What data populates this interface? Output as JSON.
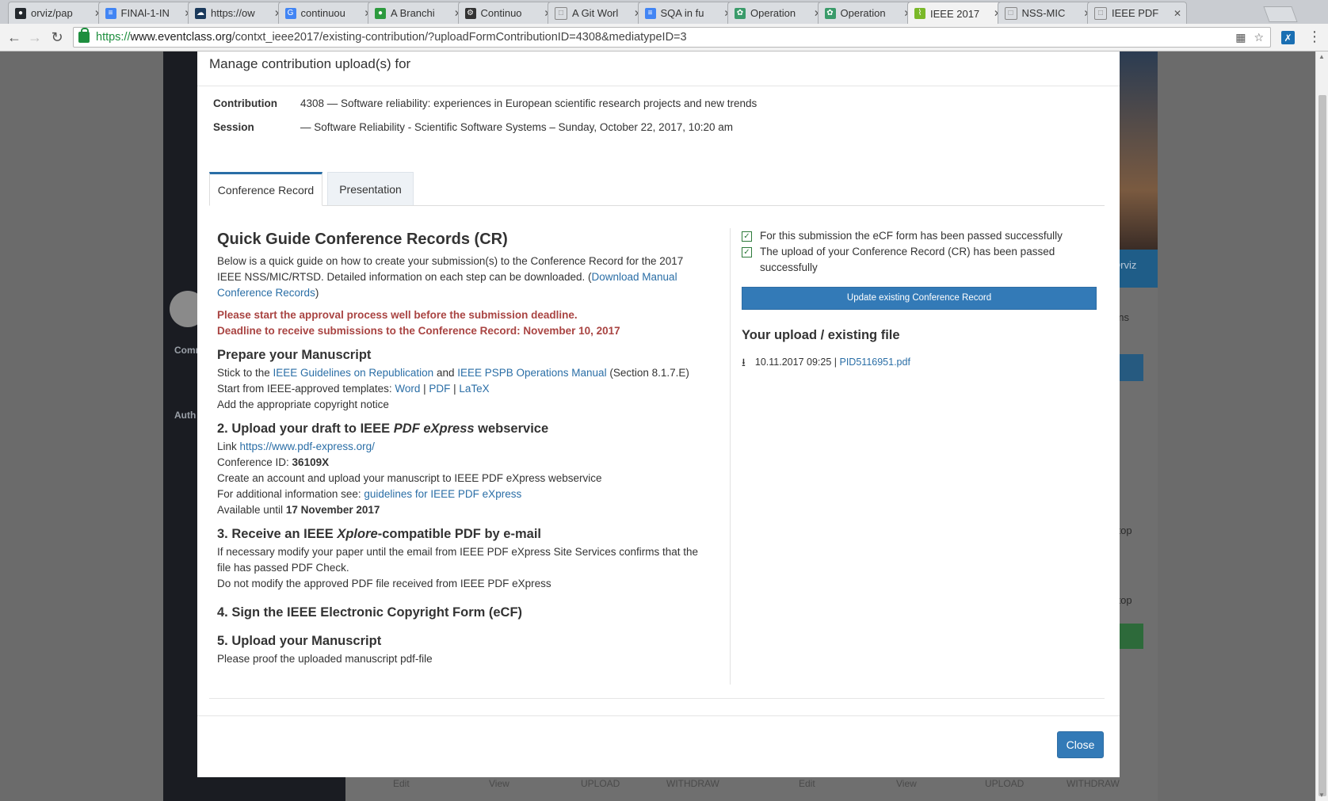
{
  "browser": {
    "tabs": [
      {
        "title": "orviz/pap",
        "icon": "github-icon",
        "color": "#24292e"
      },
      {
        "title": "FINAl-1-IN",
        "icon": "google-docs-icon",
        "color": "#4285f4"
      },
      {
        "title": "https://ow",
        "icon": "cloud-icon",
        "color": "#1b3a5c"
      },
      {
        "title": "continuou",
        "icon": "google-icon",
        "color": "#4285f4"
      },
      {
        "title": "A Branchi",
        "icon": "branch-icon",
        "color": "#2c9a3e"
      },
      {
        "title": "Continuo",
        "icon": "bug-icon",
        "color": "#333333"
      },
      {
        "title": "A Git Worl",
        "icon": "page-icon",
        "color": "#888888"
      },
      {
        "title": "SQA in fu",
        "icon": "google-docs-icon",
        "color": "#4285f4"
      },
      {
        "title": "Operation",
        "icon": "octopus-icon",
        "color": "#3a9b6a"
      },
      {
        "title": "Operation",
        "icon": "octopus-icon",
        "color": "#3a9b6a"
      },
      {
        "title": "IEEE 2017",
        "icon": "ieee-icon",
        "color": "#7ab829",
        "active": true
      },
      {
        "title": "NSS-MIC",
        "icon": "page-icon",
        "color": "#888888"
      },
      {
        "title": "IEEE PDF",
        "icon": "page-icon",
        "color": "#888888"
      }
    ],
    "url_scheme": "https://",
    "url_host": "www.eventclass.org",
    "url_path": "/contxt_ieee2017/existing-contribution/?uploadFormContributionID=4308&mediatypeID=3"
  },
  "background": {
    "sidebar_labels": [
      "Comm",
      "Auth"
    ],
    "right_texts": [
      "Orviz",
      "ons",
      "l top",
      "l top"
    ],
    "bottom_row": [
      "Edit",
      "View",
      "UPLOAD",
      "WITHDRAW",
      "Edit",
      "View",
      "UPLOAD",
      "WITHDRAW"
    ]
  },
  "modal": {
    "title": "Manage contribution upload(s) for",
    "contribution_label": "Contribution",
    "contribution_value": "4308 — Software reliability: experiences in European scientific research projects and new trends",
    "session_label": "Session",
    "session_value": " — Software Reliability - Scientific Software Systems – Sunday, October 22, 2017, 10:20 am",
    "tabs": [
      "Conference Record",
      "Presentation"
    ],
    "close_label": "Close"
  },
  "guide": {
    "title": "Quick Guide Conference Records (CR)",
    "intro": "Below is a quick guide on how to create your submission(s) to the Conference Record for the 2017 IEEE NSS/MIC/RTSD. Detailed information on each step can be downloaded. (",
    "intro_link": "Download Manual Conference Records",
    "intro_end": ")",
    "warning_1": "Please start the approval process well before the submission deadline.",
    "warning_2": "Deadline to receive submissions to the Conference Record: November 10, 2017",
    "s1_title": "Prepare your Manuscript",
    "s1_a_pre": "Stick to the ",
    "s1_a_link1": "IEEE Guidelines on Republication",
    "s1_a_mid": " and ",
    "s1_a_link2": "IEEE PSPB Operations Manual",
    "s1_a_post": " (Section 8.1.7.E)",
    "s1_b_pre": "Start from IEEE-approved templates: ",
    "s1_b_word": "Word",
    "s1_b_sep1": " | ",
    "s1_b_pdf": "PDF",
    "s1_b_sep2": " | ",
    "s1_b_latex": "LaTeX",
    "s1_c": "Add the appropriate copyright notice",
    "s2_title_pre": "2. Upload your draft to IEEE ",
    "s2_title_em": "PDF eXpress",
    "s2_title_post": " webservice",
    "s2_link_pre": "Link ",
    "s2_link": "https://www.pdf-express.org/",
    "s2_conf_pre": "Conference ID: ",
    "s2_conf_id": "36109X",
    "s2_account": "Create an account and upload your manuscript to IEEE PDF eXpress webservice",
    "s2_info_pre": "For additional information see: ",
    "s2_info_link": "guidelines for IEEE PDF eXpress",
    "s2_avail_pre": "Available until ",
    "s2_avail_date": "17 November 2017",
    "s3_title_pre": "3. Receive an IEEE ",
    "s3_title_em": "Xplore",
    "s3_title_post": "-compatible PDF by e-mail",
    "s3_a": "If necessary modify your paper until the email from IEEE PDF eXpress Site Services confirms that the file has passed PDF Check.",
    "s3_b": "Do not modify the approved PDF file received from IEEE PDF eXpress",
    "s4_title": "4. Sign the IEEE Electronic Copyright Form (eCF)",
    "s5_title": "5. Upload your Manuscript",
    "s5_a": "Please proof the uploaded manuscript pdf-file"
  },
  "status": {
    "check_1": "For this submission the eCF form has been passed successfully",
    "check_2": "The upload of your Conference Record (CR) has been passed successfully",
    "update_button": "Update existing Conference Record",
    "upload_title": "Your upload / existing file",
    "upload_datetime": "10.11.2017 09:25 | ",
    "upload_file": "PID5116951.pdf"
  },
  "colors": {
    "accent": "#337ab7",
    "link": "#2a6ea6",
    "warning": "#a94442",
    "success": "#2d7a3a"
  }
}
